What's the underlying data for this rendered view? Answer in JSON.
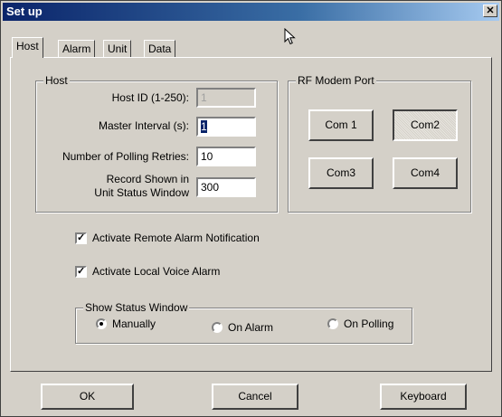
{
  "window": {
    "title": "Set up",
    "close_glyph": "✕"
  },
  "tabs": [
    "Host",
    "Alarm",
    "Unit",
    "Data"
  ],
  "host_group": {
    "legend": "Host",
    "host_id_label": "Host ID (1-250):",
    "host_id_value": "1",
    "master_interval_label": "Master Interval (s):",
    "master_interval_value": "1",
    "polling_retries_label": "Number of Polling Retries:",
    "polling_retries_value": "10",
    "record_shown_label_1": "Record Shown in",
    "record_shown_label_2": "Unit Status Window",
    "record_shown_value": "300"
  },
  "rf_modem": {
    "legend": "RF Modem Port",
    "com1": "Com 1",
    "com2": "Com2",
    "com3": "Com3",
    "com4": "Com4",
    "selected": "Com2"
  },
  "checkboxes": {
    "remote_alarm": {
      "label": "Activate Remote Alarm Notification",
      "checked": true
    },
    "local_voice": {
      "label": "Activate Local Voice Alarm",
      "checked": true
    },
    "check_glyph": "✓"
  },
  "status_window": {
    "legend": "Show Status Window",
    "options": [
      "Manually",
      "On Alarm",
      "On Polling"
    ],
    "selected": "Manually"
  },
  "footer": {
    "ok": "OK",
    "cancel": "Cancel",
    "keyboard": "Keyboard"
  },
  "icons": {
    "cursor": "mouse-pointer-icon"
  }
}
